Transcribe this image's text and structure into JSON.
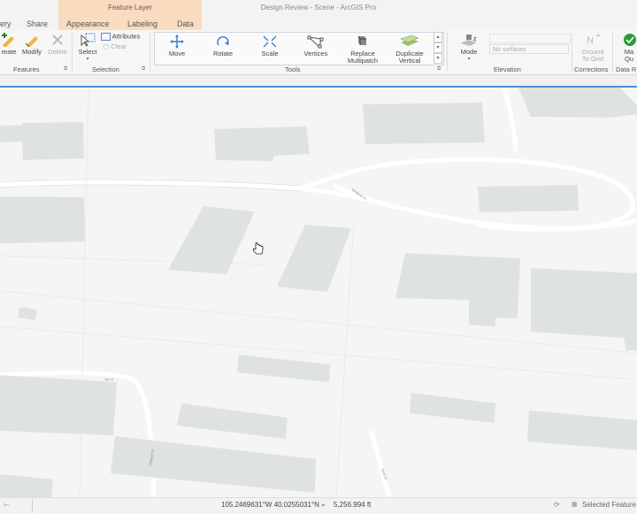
{
  "title_bar": {
    "contextual_group": "Feature Layer",
    "app_title": "Design Review - Scene - ArcGIS Pro",
    "tabs": [
      "ery",
      "Share",
      "Appearance",
      "Labeling",
      "Data"
    ]
  },
  "ribbon": {
    "features": {
      "label": "Features",
      "create": "reate",
      "modify": "Modify",
      "delete": "Delete"
    },
    "selection": {
      "label": "Selection",
      "select": "Select",
      "attributes": "Attributes",
      "clear": "Clear"
    },
    "tools": {
      "label": "Tools",
      "move": "Move",
      "rotate": "Rotate",
      "scale": "Scale",
      "vertices": "Vertices",
      "replace_1": "Replace",
      "replace_2": "Multipatch",
      "duplicate_1": "Duplicate",
      "duplicate_2": "Vertical"
    },
    "elevation": {
      "label": "Elevation",
      "mode": "Mode",
      "surface_placeholder": "No surfaces"
    },
    "corrections": {
      "label": "Corrections",
      "ground_1": "Ground",
      "ground_2": "To Grid"
    },
    "data_review": {
      "label": "Data R",
      "btn_1": "Ma",
      "btn_2": "Qu"
    }
  },
  "status": {
    "coordinates": "105.2469631°W 40.0255031°N",
    "scale": "5,256.994 ft",
    "selected": "Selected Feature"
  },
  "map_labels": {
    "street_a": "Verdent Ct",
    "street_b": "Jal Ct",
    "street_c": "Verdent Ct",
    "street_d": "Seal Ct"
  }
}
